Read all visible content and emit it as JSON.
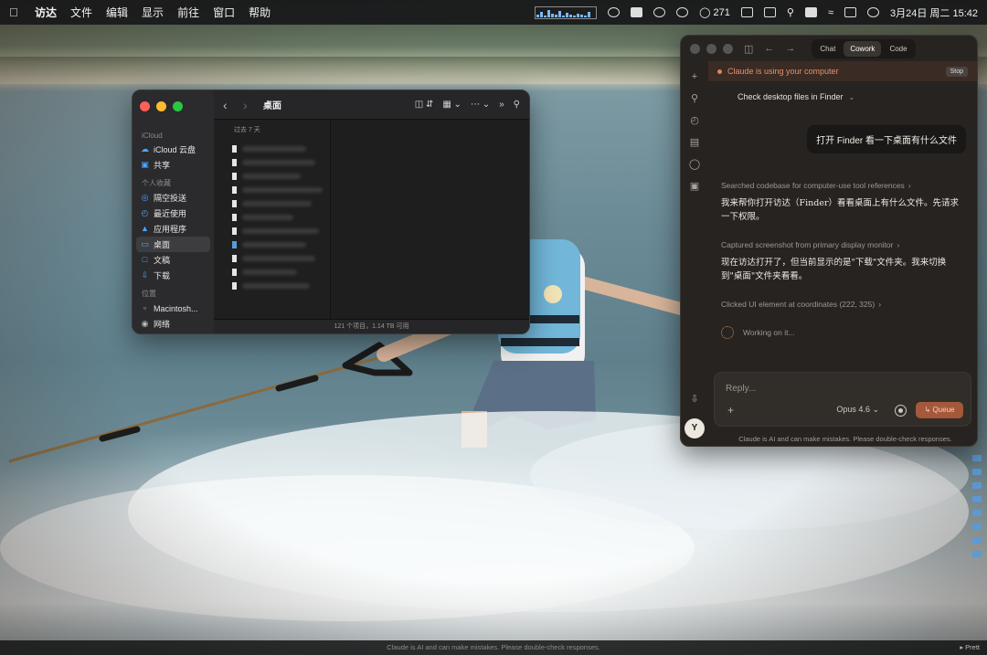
{
  "menubar": {
    "app_name": "访达",
    "items": [
      "文件",
      "编辑",
      "显示",
      "前往",
      "窗口",
      "帮助"
    ],
    "status": {
      "chat_count": "271",
      "datetime": "3月24日 周二  15:42"
    }
  },
  "finder": {
    "title": "桌面",
    "sidebar": {
      "icloud_header": "iCloud",
      "icloud_items": [
        {
          "label": "iCloud 云盘",
          "icon": "cloud-icon"
        },
        {
          "label": "共享",
          "icon": "shared-folder-icon"
        }
      ],
      "favorites_header": "个人收藏",
      "favorites_items": [
        {
          "label": "隔空投送",
          "icon": "airdrop-icon"
        },
        {
          "label": "最近使用",
          "icon": "clock-icon"
        },
        {
          "label": "应用程序",
          "icon": "applications-icon"
        },
        {
          "label": "桌面",
          "icon": "desktop-icon"
        },
        {
          "label": "文稿",
          "icon": "document-icon"
        },
        {
          "label": "下载",
          "icon": "download-icon"
        }
      ],
      "locations_header": "位置",
      "locations_items": [
        {
          "label": "Macintosh...",
          "icon": "disk-icon"
        },
        {
          "label": "网络",
          "icon": "network-icon"
        }
      ]
    },
    "column_header": "过去 7 天",
    "status_text": "121 个项目，1.14 TB 可用"
  },
  "claude": {
    "tabs": [
      "Chat",
      "Cowork",
      "Code"
    ],
    "active_tab": "Cowork",
    "banner_text": "Claude is using your computer",
    "stop_label": "Stop",
    "task_title": "Check desktop files in Finder",
    "user_message": "打开  Finder 看一下桌面有什么文件",
    "steps": [
      {
        "tool": "Searched codebase for computer-use tool references",
        "reply": "我来帮你打开访达（Finder）看看桌面上有什么文件。先请求一下权限。"
      },
      {
        "tool": "Captured screenshot from primary display monitor",
        "reply": "现在访达打开了，但当前显示的是\"下载\"文件夹。我来切换到\"桌面\"文件夹看看。"
      },
      {
        "tool": "Clicked UI element at coordinates (222, 325)",
        "reply": ""
      }
    ],
    "working_text": "Working on it...",
    "composer": {
      "placeholder": "Reply...",
      "model": "Opus 4.6",
      "queue_label": "Queue"
    },
    "disclaimer": "Claude is AI and can make mistakes. Please double-check responses.",
    "avatar_letter": "Y"
  },
  "bottom_strip": {
    "text": "Claude is AI and can make mistakes. Please double-check responses.",
    "corner": "▸ Prett"
  },
  "colors": {
    "accent": "#d97757",
    "finder_blue": "#4da3ff"
  }
}
